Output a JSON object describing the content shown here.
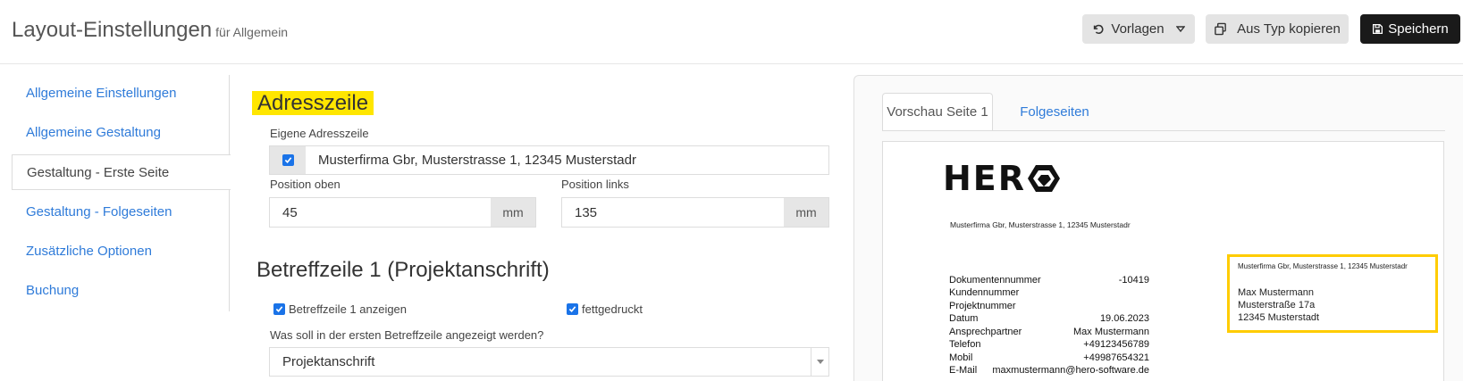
{
  "header": {
    "title": "Layout-Einstellungen",
    "subtitle": "für Allgemein",
    "templates_label": "Vorlagen",
    "copy_label": "Aus Typ kopieren",
    "save_label": "Speichern"
  },
  "sidebar": {
    "items": [
      {
        "label": "Allgemeine Einstellungen",
        "active": false
      },
      {
        "label": "Allgemeine Gestaltung",
        "active": false
      },
      {
        "label": "Gestaltung - Erste Seite",
        "active": true
      },
      {
        "label": "Gestaltung - Folgeseiten",
        "active": false
      },
      {
        "label": "Zusätzliche Optionen",
        "active": false
      },
      {
        "label": "Buchung",
        "active": false
      }
    ]
  },
  "address_section": {
    "title": "Adresszeile",
    "own_label": "Eigene Adresszeile",
    "own_checked": true,
    "own_value": "Musterfirma Gbr, Musterstrasse 1, 12345 Musterstadr",
    "pos_top_label": "Position oben",
    "pos_top_value": "45",
    "pos_top_unit": "mm",
    "pos_left_label": "Position links",
    "pos_left_value": "135",
    "pos_left_unit": "mm"
  },
  "subject_section": {
    "title": "Betreffzeile 1 (Projektanschrift)",
    "show_label": "Betreffzeile 1 anzeigen",
    "show_checked": true,
    "bold_label": "fettgedruckt",
    "bold_checked": true,
    "question_label": "Was soll in der ersten Betreffzeile angezeigt werden?",
    "select_value": "Projektanschrift"
  },
  "preview": {
    "tab_first": "Vorschau Seite 1",
    "tab_following": "Folgeseiten",
    "logo_text": "HER",
    "sender_line": "Musterfirma Gbr, Musterstrasse 1, 12345 Musterstadr",
    "box_sender_line": "Musterfirma Gbr, Musterstrasse 1, 12345 Musterstadr",
    "recipient": {
      "name": "Max Mustermann",
      "street": "Musterstraße 17a",
      "city": "12345 Musterstadt"
    },
    "meta": [
      {
        "label": "Dokumentennummer",
        "value": "-10419"
      },
      {
        "label": "Kundennummer",
        "value": ""
      },
      {
        "label": "Projektnummer",
        "value": ""
      },
      {
        "label": "Datum",
        "value": "19.06.2023"
      },
      {
        "label": "Ansprechpartner",
        "value": "Max Mustermann"
      },
      {
        "label": "Telefon",
        "value": "+49123456789"
      },
      {
        "label": "Mobil",
        "value": "+49987654321"
      },
      {
        "label": "E-Mail",
        "value": "maxmustermann@hero-software.de"
      }
    ],
    "highlight_color": "#ffcc00"
  },
  "colors": {
    "link": "#2f7bd9",
    "highlight": "#ffe600",
    "checkbox": "#1a73e8",
    "dark_button": "#1a1a1a"
  }
}
